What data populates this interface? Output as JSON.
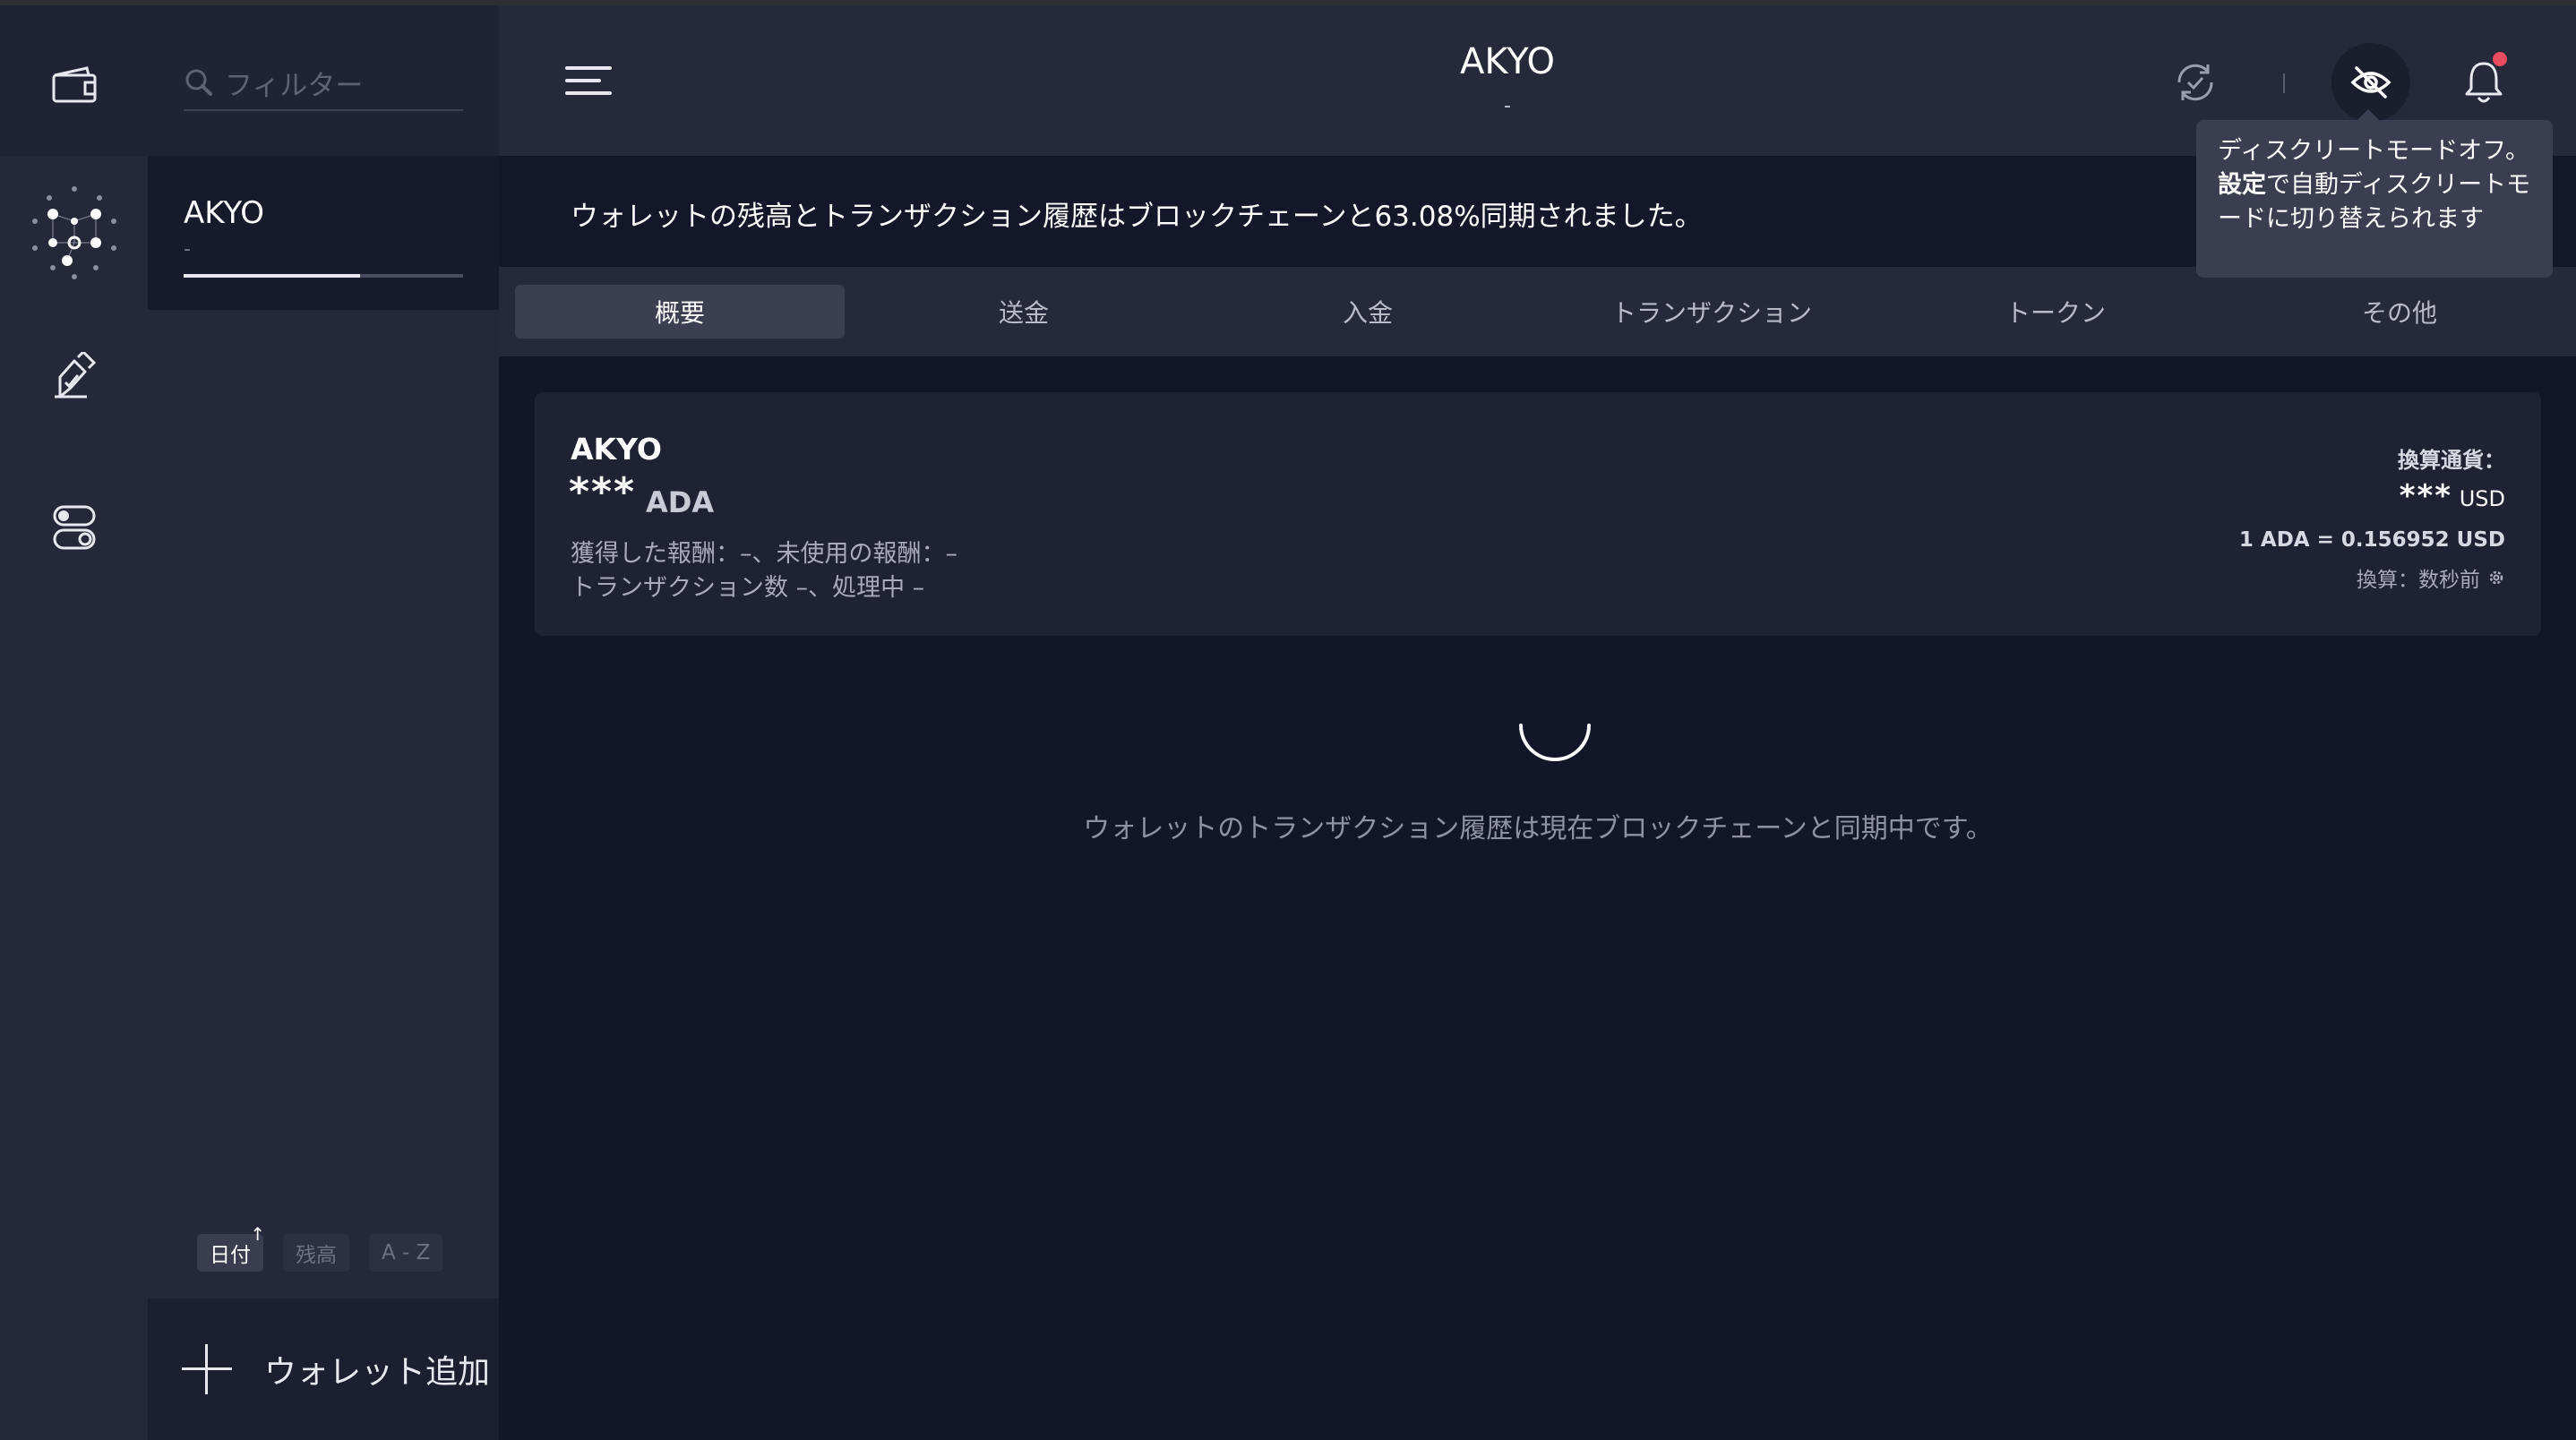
{
  "sidebar": {
    "icons": [
      "wallet-icon",
      "network-icon",
      "pen-icon",
      "toggle-settings-icon"
    ]
  },
  "wallet_list": {
    "filter_placeholder": "フィルター",
    "wallets": [
      {
        "name": "AKYO",
        "subtitle": "-",
        "sync_progress": 0.6308
      }
    ],
    "sort": {
      "date": "日付",
      "date_arrow": "↑",
      "balance": "残高",
      "az": "A - Z"
    },
    "add_wallet": "ウォレット追加"
  },
  "header": {
    "title": "AKYO",
    "subtitle": "-",
    "icons": [
      "menu-icon",
      "sync-icon",
      "discreet-mode-icon",
      "bell-icon"
    ]
  },
  "banner": {
    "text": "ウォレットの残高とトランザクション履歴はブロックチェーンと63.08%同期されました。"
  },
  "tabs": [
    "概要",
    "送金",
    "入金",
    "トランザクション",
    "トークン",
    "その他"
  ],
  "active_tab": 0,
  "summary": {
    "wallet_name": "AKYO",
    "balance": "***",
    "unit": "ADA",
    "rewards_line": "獲得した報酬：–、未使用の報酬：–",
    "tx_line": "トランザクション数 –、処理中 –",
    "conversion_label": "換算通貨：",
    "converted_balance": "***",
    "converted_unit": "USD",
    "rate": "1 ADA = 0.156952 USD",
    "updated": "換算：数秒前"
  },
  "sync_message": "ウォレットのトランザクション履歴は現在ブロックチェーンと同期中です。",
  "tooltip": {
    "prefix": "ディスクリートモードオフ。",
    "bold": "設定",
    "suffix": "で自動ディスクリートモードに切り替えられます"
  },
  "colors": {
    "background": "#131529",
    "panel": "#262939",
    "notification": "#ea4c5f"
  }
}
